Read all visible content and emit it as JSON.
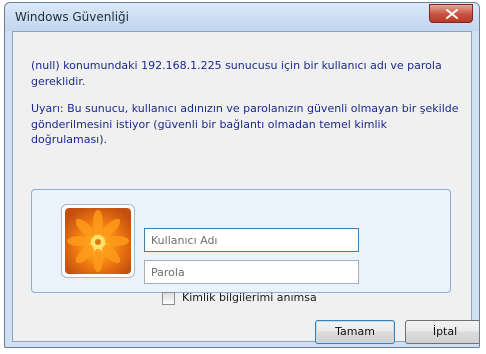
{
  "window": {
    "title": "Windows Güvenliği",
    "close_icon": "close-icon"
  },
  "message": {
    "line1": "(null) konumundaki 192.168.1.225 sunucusu için bir kullanıcı adı ve parola gereklidir.",
    "warning": "Uyarı: Bu sunucu, kullanıcı adınızın ve parolanızın güvenli olmayan bir şekilde gönderilmesini istiyor (güvenli bir bağlantı olmadan temel kimlik doğrulaması)."
  },
  "credentials": {
    "user_tile_icon": "flower-user-picture-icon",
    "username_placeholder": "Kullanıcı Adı",
    "username_value": "",
    "password_placeholder": "Parola",
    "password_value": "",
    "remember_label": "Kimlik bilgilerimi anımsa",
    "remember_checked": false
  },
  "buttons": {
    "ok_label": "Tamam",
    "cancel_label": "İptal"
  },
  "colors": {
    "message_text": "#1a2a8c",
    "close_button": "#c9503f",
    "panel_background": "#eaf2fb"
  }
}
